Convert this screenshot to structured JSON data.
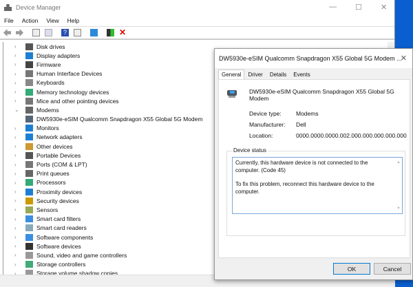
{
  "window": {
    "title": "Device Manager",
    "minimize": "—",
    "maximize": "☐",
    "close": "✕"
  },
  "menu": [
    "File",
    "Action",
    "View",
    "Help"
  ],
  "toolbar_icons": [
    "back-icon",
    "forward-icon",
    "properties-icon",
    "show-hidden-icon",
    "help-icon",
    "update-driver-icon",
    "scan-hardware-icon",
    "enable-device-icon",
    "uninstall-icon"
  ],
  "tree": [
    {
      "label": "Disk drives",
      "color": "#555"
    },
    {
      "label": "Display adapters",
      "color": "#1e7fd0"
    },
    {
      "label": "Firmware",
      "color": "#444"
    },
    {
      "label": "Human Interface Devices",
      "color": "#777"
    },
    {
      "label": "Keyboards",
      "color": "#888"
    },
    {
      "label": "Memory technology devices",
      "color": "#3a7"
    },
    {
      "label": "Mice and other pointing devices",
      "color": "#777"
    },
    {
      "label": "Modems",
      "color": "#666",
      "expanded": true
    },
    {
      "label": "DW5930e-eSIM Qualcomm Snapdragon X55 Global 5G Modem",
      "color": "#567",
      "child": true
    },
    {
      "label": "Monitors",
      "color": "#1e7fd0"
    },
    {
      "label": "Network adapters",
      "color": "#1e7fd0"
    },
    {
      "label": "Other devices",
      "color": "#c93"
    },
    {
      "label": "Portable Devices",
      "color": "#555"
    },
    {
      "label": "Ports (COM & LPT)",
      "color": "#777"
    },
    {
      "label": "Print queues",
      "color": "#666"
    },
    {
      "label": "Processors",
      "color": "#3a7"
    },
    {
      "label": "Proximity devices",
      "color": "#1e7fd0"
    },
    {
      "label": "Security devices",
      "color": "#c90"
    },
    {
      "label": "Sensors",
      "color": "#9a5"
    },
    {
      "label": "Smart card filters",
      "color": "#3b8fe0"
    },
    {
      "label": "Smart card readers",
      "color": "#8ab"
    },
    {
      "label": "Software components",
      "color": "#3b8fe0"
    },
    {
      "label": "Software devices",
      "color": "#333"
    },
    {
      "label": "Sound, video and game controllers",
      "color": "#999"
    },
    {
      "label": "Storage controllers",
      "color": "#4a7"
    },
    {
      "label": "Storage volume shadow copies",
      "color": "#999"
    }
  ],
  "dialog": {
    "title": "DW5930e-eSIM Qualcomm Snapdragon X55 Global 5G Modem ...",
    "close": "✕",
    "tabs": [
      "General",
      "Driver",
      "Details",
      "Events"
    ],
    "device_name": "DW5930e-eSIM Qualcomm Snapdragon X55 Global 5G Modem",
    "props": [
      {
        "key": "Device type:",
        "value": "Modems"
      },
      {
        "key": "Manufacturer:",
        "value": "Dell"
      },
      {
        "key": "Location:",
        "value": "0000.0000.0000.002.000.000.000.000.000"
      }
    ],
    "status_label": "Device status",
    "status_line1": "Currently, this hardware device is not connected to the computer. (Code 45)",
    "status_line2": "To fix this problem, reconnect this hardware device to the computer.",
    "ok": "OK",
    "cancel": "Cancel"
  }
}
